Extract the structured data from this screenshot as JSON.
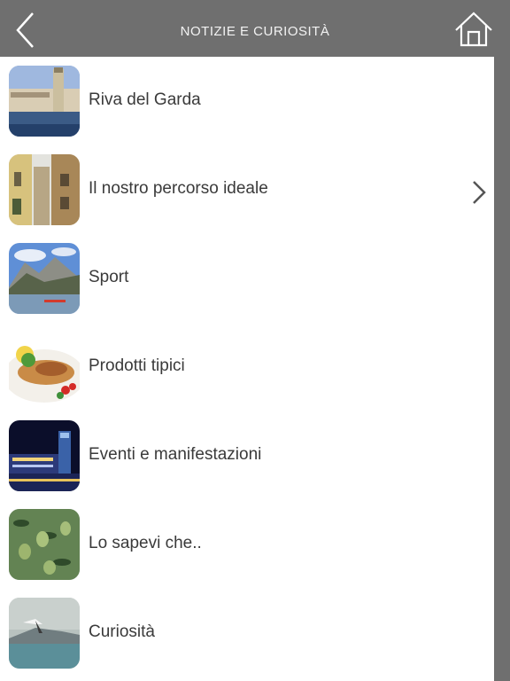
{
  "header": {
    "title": "NOTIZIE E CURIOSITÀ",
    "back_icon": "chevron-left-icon",
    "home_icon": "home-icon"
  },
  "items": [
    {
      "label": "Riva del Garda",
      "thumb": "riva-del-garda-photo"
    },
    {
      "label": "Il nostro percorso ideale",
      "thumb": "old-town-alley-photo",
      "selected": true
    },
    {
      "label": "Sport",
      "thumb": "lake-mountains-photo"
    },
    {
      "label": "Prodotti tipici",
      "thumb": "fish-dish-photo"
    },
    {
      "label": "Eventi e manifestazioni",
      "thumb": "night-town-photo"
    },
    {
      "label": "Lo sapevi che..",
      "thumb": "olive-branch-photo"
    },
    {
      "label": "Curiosità",
      "thumb": "seagull-lake-photo"
    }
  ],
  "colors": {
    "bar": "#6f6f6f",
    "text": "#3a3a3a",
    "background": "#ffffff"
  }
}
